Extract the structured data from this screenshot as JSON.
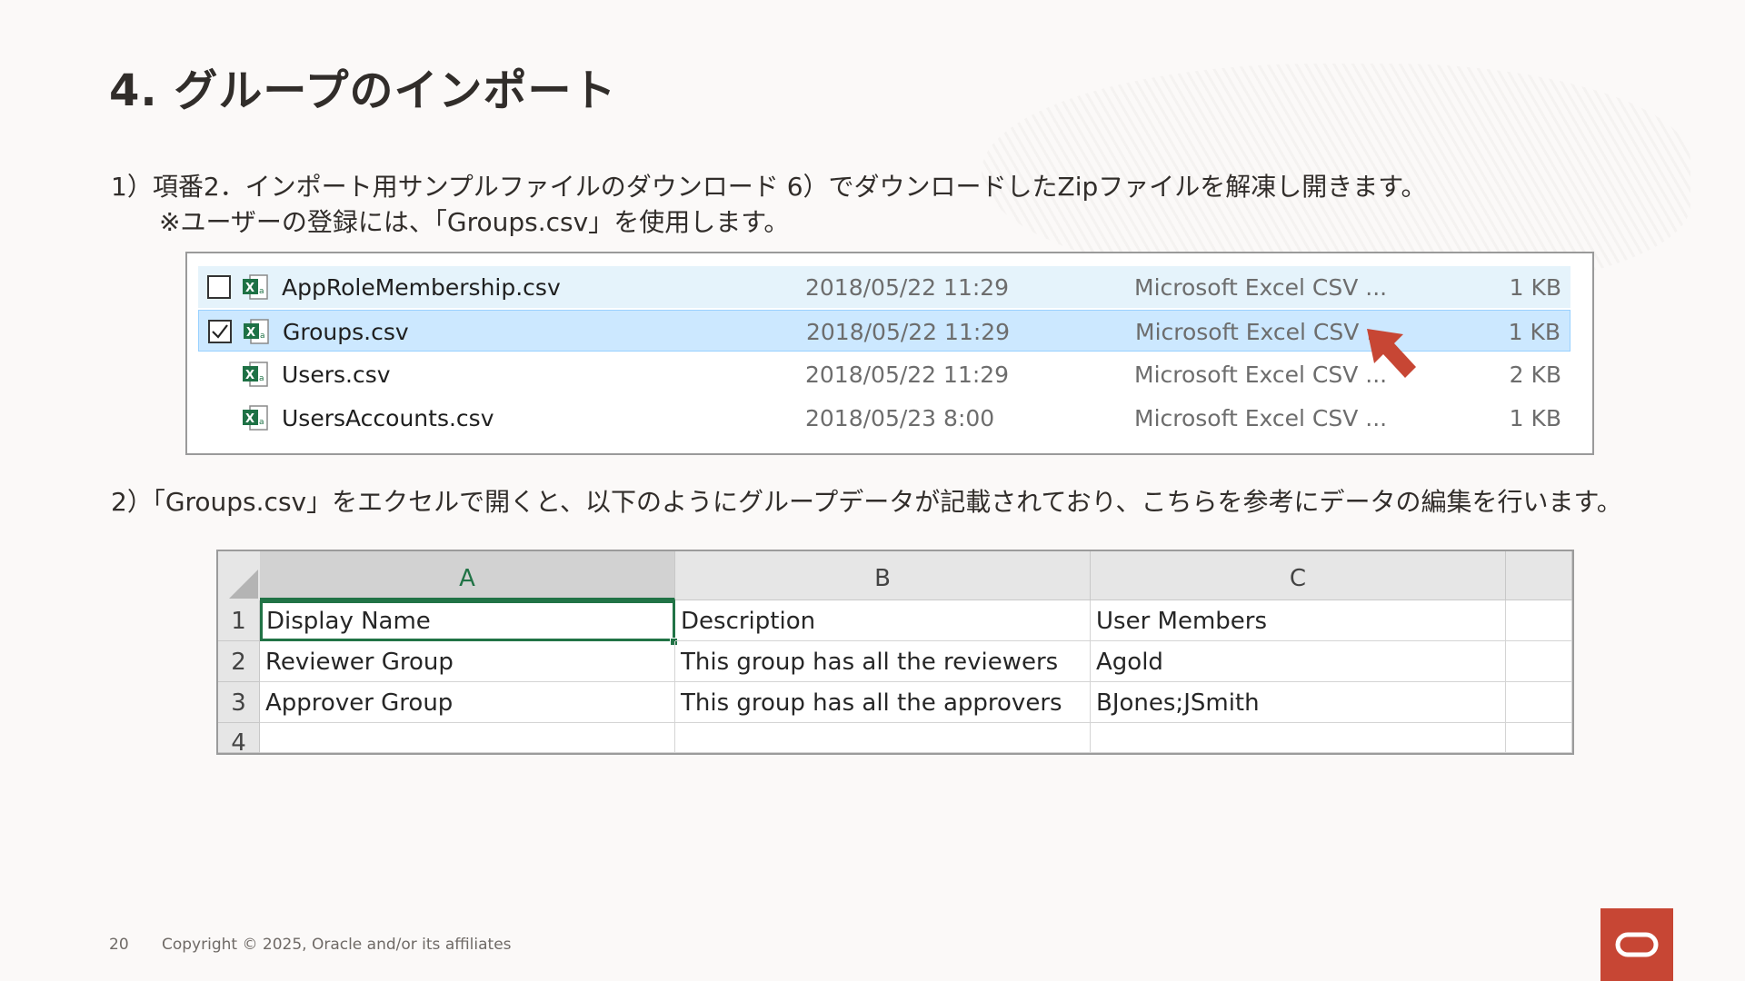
{
  "slide": {
    "title": "4. グループのインポート",
    "step1_line1": "1）項番2．インポート用サンプルファイルのダウンロード 6）でダウンロードしたZipファイルを解凍し開きます。",
    "step1_line2": "※ユーザーの登録には、「Groups.csv」を使用します。",
    "step2": "2）「Groups.csv」をエクセルで開くと、以下のようにグループデータが記載されており、こちらを参考にデータの編集を行います。",
    "page_number": "20",
    "copyright": "Copyright © 2025, Oracle and/or its affiliates"
  },
  "explorer": {
    "files": [
      {
        "name": "AppRoleMembership.csv",
        "date": "2018/05/22 11:29",
        "type": "Microsoft Excel CSV ...",
        "size": "1 KB",
        "checked": false,
        "state": "hover"
      },
      {
        "name": "Groups.csv",
        "date": "2018/05/22 11:29",
        "type": "Microsoft Excel CSV ...",
        "size": "1 KB",
        "checked": true,
        "state": "selected"
      },
      {
        "name": "Users.csv",
        "date": "2018/05/22 11:29",
        "type": "Microsoft Excel CSV ...",
        "size": "2 KB",
        "checked": false,
        "state": "none"
      },
      {
        "name": "UsersAccounts.csv",
        "date": "2018/05/23 8:00",
        "type": "Microsoft Excel CSV ...",
        "size": "1 KB",
        "checked": false,
        "state": "none"
      }
    ],
    "icon": "excel-csv-file-icon"
  },
  "sheet": {
    "columns": [
      "A",
      "B",
      "C"
    ],
    "row_numbers": [
      "1",
      "2",
      "3",
      "4"
    ],
    "rows": [
      [
        "Display Name",
        "Description",
        "User Members"
      ],
      [
        "Reviewer Group",
        "This group has all the reviewers",
        "Agold"
      ],
      [
        "Approver Group",
        "This group has all the approvers",
        "BJones;JSmith"
      ],
      [
        "",
        "",
        ""
      ]
    ],
    "active_cell": "A1",
    "accent_color": "#217346"
  },
  "colors": {
    "brand_red": "#c74634",
    "selection_blue": "#cce8ff",
    "hover_blue": "#e5f3fb"
  }
}
